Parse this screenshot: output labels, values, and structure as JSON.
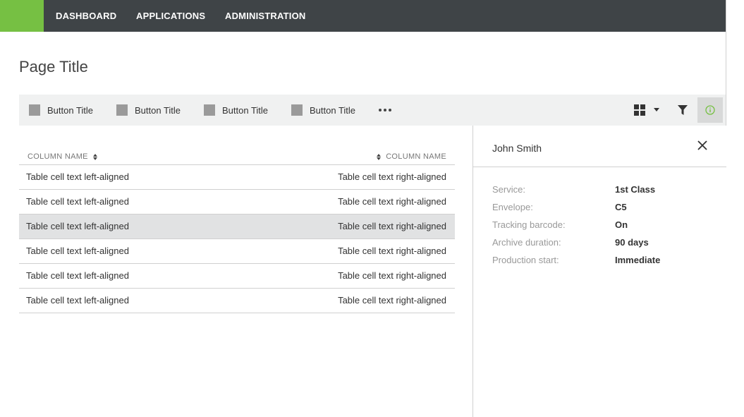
{
  "nav": {
    "items": [
      {
        "label": "DASHBOARD"
      },
      {
        "label": "APPLICATIONS"
      },
      {
        "label": "ADMINISTRATION"
      }
    ],
    "brand_color": "#76c043",
    "bar_color": "#3f4447"
  },
  "page": {
    "title": "Page Title"
  },
  "toolbar": {
    "buttons": [
      {
        "label": "Button Title"
      },
      {
        "label": "Button Title"
      },
      {
        "label": "Button Title"
      },
      {
        "label": "Button Title"
      }
    ],
    "icons": [
      "more-icon",
      "grid-view-icon",
      "caret-down-icon",
      "filter-icon",
      "info-icon"
    ],
    "info_active_color": "#76c043"
  },
  "table": {
    "columns": [
      {
        "label": "COLUMN NAME"
      },
      {
        "label": "COLUMN NAME"
      }
    ],
    "rows": [
      {
        "left": "Table cell text left-aligned",
        "right": "Table cell text right-aligned"
      },
      {
        "left": "Table cell text left-aligned",
        "right": "Table cell text right-aligned"
      },
      {
        "left": "Table cell text left-aligned",
        "right": "Table cell text right-aligned"
      },
      {
        "left": "Table cell text left-aligned",
        "right": "Table cell text right-aligned"
      },
      {
        "left": "Table cell text left-aligned",
        "right": "Table cell text right-aligned"
      },
      {
        "left": "Table cell text left-aligned",
        "right": "Table cell text right-aligned"
      }
    ],
    "selected_row": 2
  },
  "panel": {
    "title": "John Smith",
    "details": [
      {
        "key": "Service:",
        "value": "1st Class"
      },
      {
        "key": "Envelope:",
        "value": "C5"
      },
      {
        "key": "Tracking barcode:",
        "value": "On"
      },
      {
        "key": "Archive duration:",
        "value": "90 days"
      },
      {
        "key": "Production start:",
        "value": "Immediate"
      }
    ]
  }
}
